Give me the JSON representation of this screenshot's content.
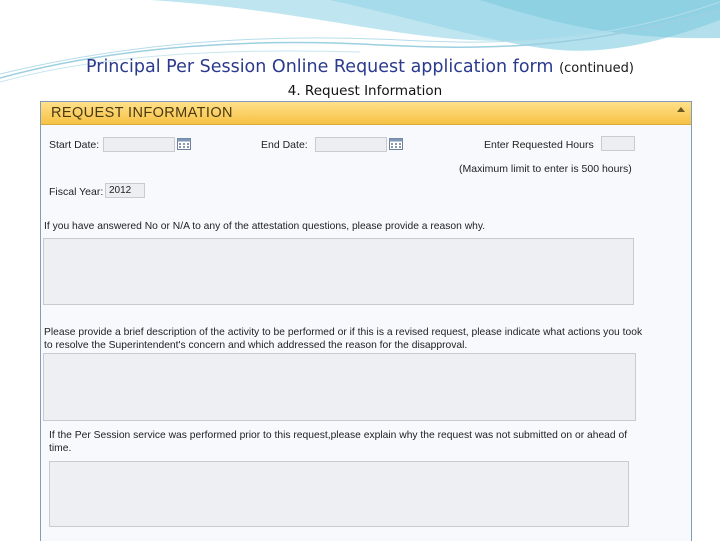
{
  "slide": {
    "title": "Principal Per Session Online Request application form",
    "title_suffix": "(continued)",
    "subtitle": "4. Request Information"
  },
  "form": {
    "header_title": "REQUEST INFORMATION",
    "start_date_label": "Start Date:",
    "start_date_value": "",
    "end_date_label": "End Date:",
    "end_date_value": "",
    "hours_label": "Enter Requested Hours",
    "hours_value": "",
    "hours_note": "(Maximum limit to enter is 500 hours)",
    "fiscal_year_label": "Fiscal Year:",
    "fiscal_year_value": "2012",
    "reason_prompt": "If you have answered No or N/A to any of the attestation questions, please provide a reason why.",
    "reason_value": "",
    "description_prompt": "Please provide a brief description of the activity to be performed or if this is a revised request, please indicate what actions you took to resolve the Superintendent's concern and which addressed the reason for the disapproval.",
    "description_value": "",
    "prior_prompt": "If the Per Session service was performed prior to this request,please explain why the request was not submitted on or ahead of time.",
    "prior_value": ""
  },
  "colors": {
    "header_bar": "#f6c245",
    "title_text": "#2b3a8c",
    "form_border": "#7f9db9"
  },
  "icons": {
    "calendar": "calendar-icon",
    "collapse": "collapse-arrow-icon"
  }
}
